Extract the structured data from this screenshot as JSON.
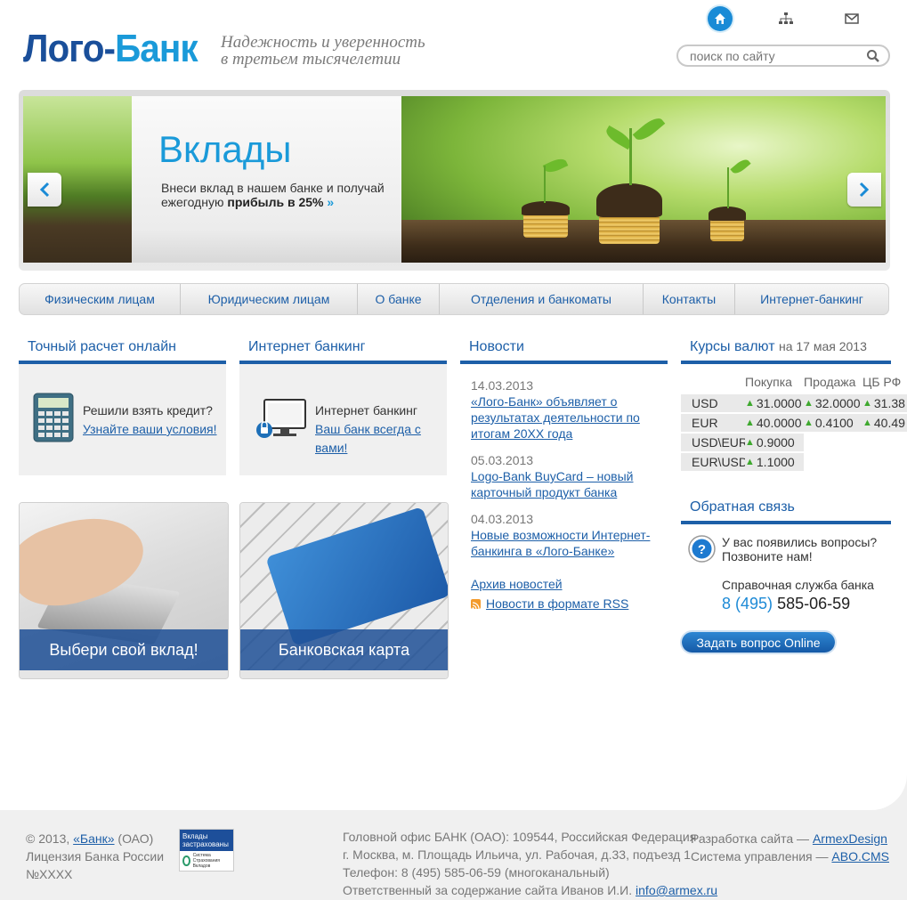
{
  "header": {
    "logo_part1": "Лого-",
    "logo_part2": "Банк",
    "slogan_line1": "Надежность и уверенность",
    "slogan_line2": "в третьем тысячелетии",
    "search_placeholder": "поиск по сайту",
    "icons": [
      "home-icon",
      "sitemap-icon",
      "mail-icon"
    ]
  },
  "slider": {
    "title": "Вклады",
    "desc_line1": "Внеси вклад в нашем банке и получай",
    "desc_line2_plain": "ежегодную ",
    "desc_line2_bold": "прибыль в 25%",
    "arrow": "»"
  },
  "nav": {
    "items": [
      {
        "label": "Физическим лицам"
      },
      {
        "label": "Юридическим лицам"
      },
      {
        "label": "О банке"
      },
      {
        "label": "Отделения и банкоматы"
      },
      {
        "label": "Контакты"
      },
      {
        "label": "Интернет-банкинг"
      }
    ]
  },
  "calc": {
    "title": "Точный расчет онлайн",
    "text": "Решили взять кредит?",
    "link": "Узнайте ваши условия!"
  },
  "ibank": {
    "title": "Интернет банкинг",
    "text": "Интернет банкинг",
    "link": "Ваш банк всегда с вами!"
  },
  "promos": [
    {
      "label": "Выбери свой вклад!"
    },
    {
      "label": "Банковская карта"
    }
  ],
  "news": {
    "title": "Новости",
    "items": [
      {
        "date": "14.03.2013",
        "link": "«Лого-Банк» объявляет о результатах деятельности по итогам 20ХХ года"
      },
      {
        "date": "05.03.2013",
        "link": "Logo-Bank BuyCard – новый карточный продукт банка"
      },
      {
        "date": "04.03.2013",
        "link": "Новые возможности Интернет-банкинга в «Лого-Банке»"
      }
    ],
    "archive": "Архив новостей",
    "rss": "Новости в формате RSS"
  },
  "currency": {
    "title": "Курсы валют",
    "date": "на 17 мая 2013",
    "headers": [
      "Покупка",
      "Продажа",
      "ЦБ РФ"
    ],
    "rows": [
      {
        "name": "USD",
        "values": [
          "31.0000",
          "32.0000",
          "31.38"
        ]
      },
      {
        "name": "EUR",
        "values": [
          "40.0000",
          "0.4100",
          "40.49"
        ]
      },
      {
        "name": "USD\\EUR",
        "values": [
          "0.9000"
        ]
      },
      {
        "name": "EUR\\USD",
        "values": [
          "1.1000"
        ]
      }
    ]
  },
  "feedback": {
    "title": "Обратная связь",
    "question_line1": "У вас появились вопросы?",
    "question_line2": "Позвоните нам!",
    "help_label": "Справочная служба банка",
    "phone_code": "8 (495)",
    "phone_number": "585-06-59",
    "button": "Задать вопрос Online"
  },
  "footer": {
    "copyright_prefix": "© 2013, ",
    "bank_link": "«Банк»",
    "copyright_suffix": " (ОАО)",
    "license_line1": "Лицензия Банка России",
    "license_line2": "№XXXX",
    "badge_top": "Вклады застрахованы",
    "badge_bottom": "Система Страхования Вкладов",
    "office_line1": "Головной офис БАНК (ОАО): 109544, Российская Федерация",
    "office_line2": "г. Москва, м. Площадь Ильича, ул. Рабочая, д.33, подъезд 1",
    "phone_line": "Телефон: 8 (495) 585-06-59 (многоканальный)",
    "responsible_prefix": "Ответственный за содержание сайта Иванов И.И. ",
    "responsible_email": "info@armex.ru",
    "dev_prefix": "Разработка сайта — ",
    "dev_link": "ArmexDesign",
    "cms_prefix": "Система управления — ",
    "cms_link": "ABO.CMS"
  },
  "colors": {
    "brand_dark": "#1a4f9a",
    "brand_light": "#1a9ad9",
    "link": "#1d5fa8",
    "up_arrow": "#3ea82e"
  }
}
